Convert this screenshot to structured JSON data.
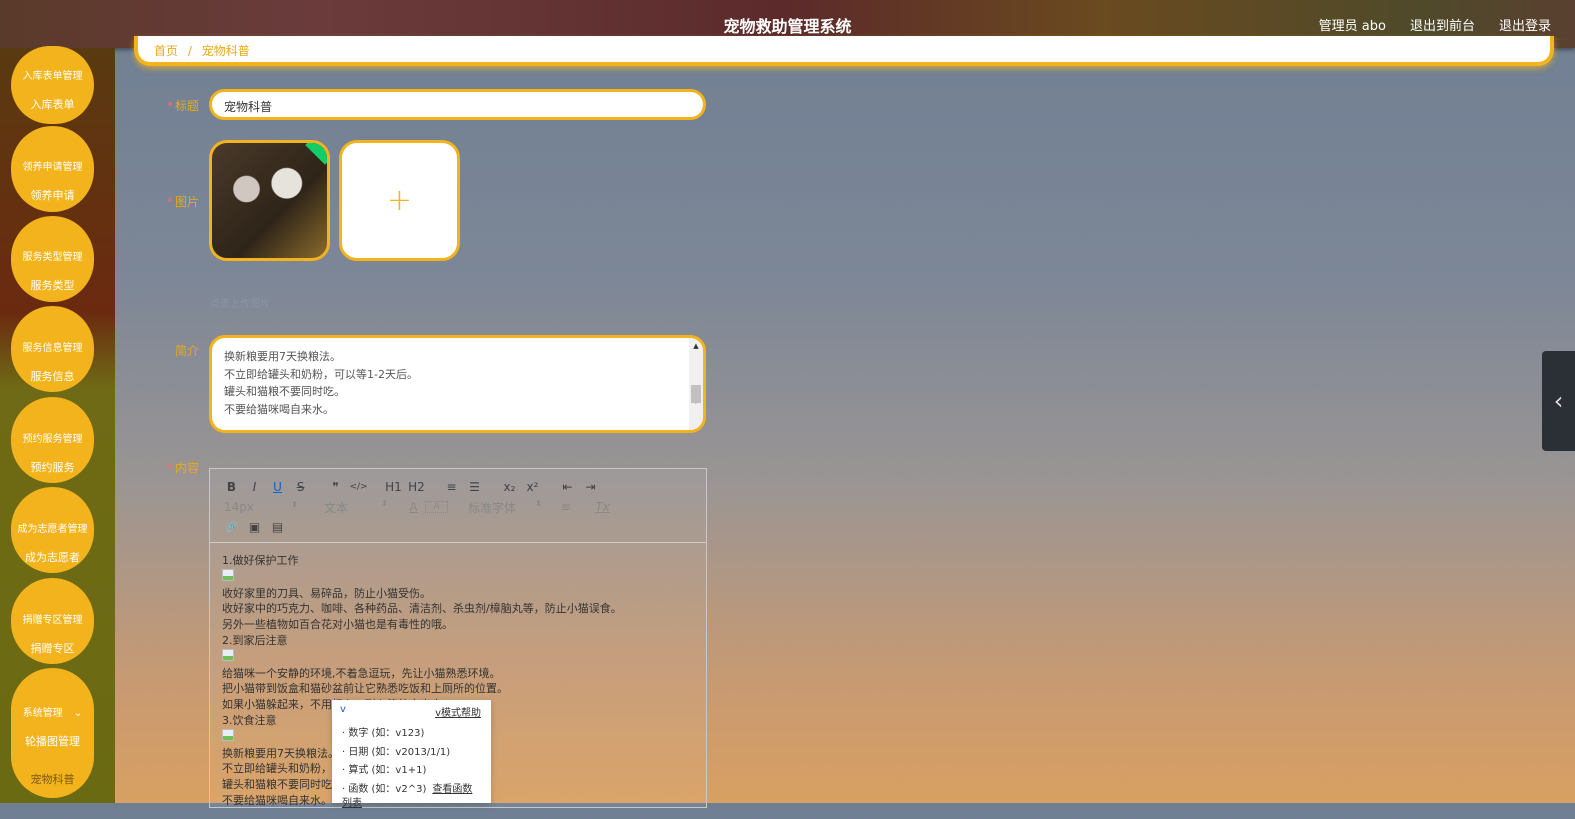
{
  "header": {
    "title": "宠物救助管理系统",
    "user": "管理员 abo",
    "front": "退出到前台",
    "logout": "退出登录"
  },
  "sidebar": [
    {
      "title": "入库表单管理",
      "sub": "入库表单"
    },
    {
      "title": "领养申请管理",
      "sub": "领养申请"
    },
    {
      "title": "服务类型管理",
      "sub": "服务类型"
    },
    {
      "title": "服务信息管理",
      "sub": "服务信息"
    },
    {
      "title": "预约服务管理",
      "sub": "预约服务"
    },
    {
      "title": "成为志愿者管理",
      "sub": "成为志愿者"
    },
    {
      "title": "捐赠专区管理",
      "sub": "捐赠专区"
    },
    {
      "title": "系统管理",
      "sub": "轮播图管理",
      "sub2": "宠物科普"
    }
  ],
  "breadcrumb": {
    "home": "首页",
    "sep": "/",
    "current": "宠物科普"
  },
  "form": {
    "title_label": "标题",
    "title_value": "宠物科普",
    "image_label": "图片",
    "upload_plus": "+",
    "upload_hint": "点击上传图片",
    "intro_label": "简介",
    "intro_lines": [
      "换新粮要用7天换粮法。",
      "不立即给罐头和奶粉，可以等1-2天后。",
      "罐头和猫粮不要同时吃。",
      "不要给猫咪喝自来水。"
    ],
    "content_label": "内容"
  },
  "editor": {
    "toolbar1": [
      "B",
      "I",
      "U",
      "S",
      "❞",
      "</>",
      "H1",
      "H2",
      "≡",
      "☰",
      "x₂",
      "x²",
      "⇤",
      "⇥"
    ],
    "size": "14px",
    "header": "文本",
    "color": "A",
    "bg": "A",
    "font": "标准字体",
    "align": "≡",
    "clean": "Tx",
    "toolbar3": [
      "🔗",
      "▣",
      "▤"
    ],
    "lines": [
      "1.做好保护工作",
      "[img]",
      "收好家里的刀具、易碎品，防止小猫受伤。",
      "收好家中的巧克力、咖啡、各种药品、清洁剂、杀虫剂/樟脑丸等，防止小猫误食。",
      "另外一些植物如百合花对小猫也是有毒性的哦。",
      "2.到家后注意",
      "[img]",
      "给猫咪一个安静的环境,不着急逗玩，先让小猫熟悉环境。",
      "把小猫带到饭盒和猫砂盆前让它熟悉吃饭和上厕所的位置。",
      "如果小猫躲起来，不用担心，耐心等待它出来。",
      "3.饮食注意",
      "[img]",
      "换新粮要用7天换粮法。",
      "不立即给罐头和奶粉，可以等1-2天后。",
      "罐头和猫粮不要同时吃。",
      "不要给猫咪喝自来水。"
    ]
  },
  "ime_popup": {
    "input": "v",
    "help": "v模式帮助",
    "items": [
      "· 数字 (如：v123)",
      "· 日期 (如：v2013/1/1)",
      "· 算式 (如：v1+1)",
      "· 函数 (如：v2^3)"
    ],
    "func_link": "查看函数列表"
  },
  "side_toggle": "‹"
}
